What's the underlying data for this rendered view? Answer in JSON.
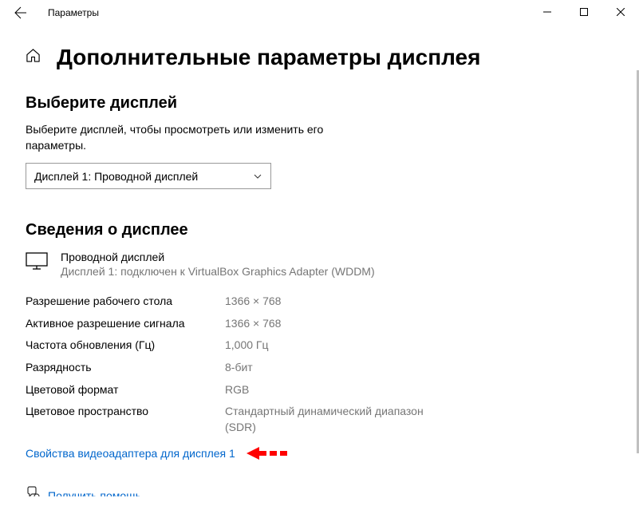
{
  "window": {
    "title": "Параметры"
  },
  "page": {
    "title": "Дополнительные параметры дисплея"
  },
  "select_section": {
    "title": "Выберите дисплей",
    "description": "Выберите дисплей, чтобы просмотреть или изменить его параметры.",
    "dropdown_value": "Дисплей 1: Проводной дисплей"
  },
  "info_section": {
    "title": "Сведения о дисплее",
    "display_name": "Проводной дисплей",
    "display_sub": "Дисплей 1: подключен к VirtualBox Graphics Adapter (WDDM)",
    "rows": [
      {
        "label": "Разрешение рабочего стола",
        "value": "1366 × 768"
      },
      {
        "label": "Активное разрешение сигнала",
        "value": "1366 × 768"
      },
      {
        "label": "Частота обновления (Гц)",
        "value": "1,000 Гц"
      },
      {
        "label": "Разрядность",
        "value": "8-бит"
      },
      {
        "label": "Цветовой формат",
        "value": "RGB"
      },
      {
        "label": "Цветовое пространство",
        "value": "Стандартный динамический диапазон (SDR)"
      }
    ],
    "adapter_link": "Свойства видеоадаптера для дисплея 1"
  },
  "help": {
    "link": "Получить помощь"
  }
}
